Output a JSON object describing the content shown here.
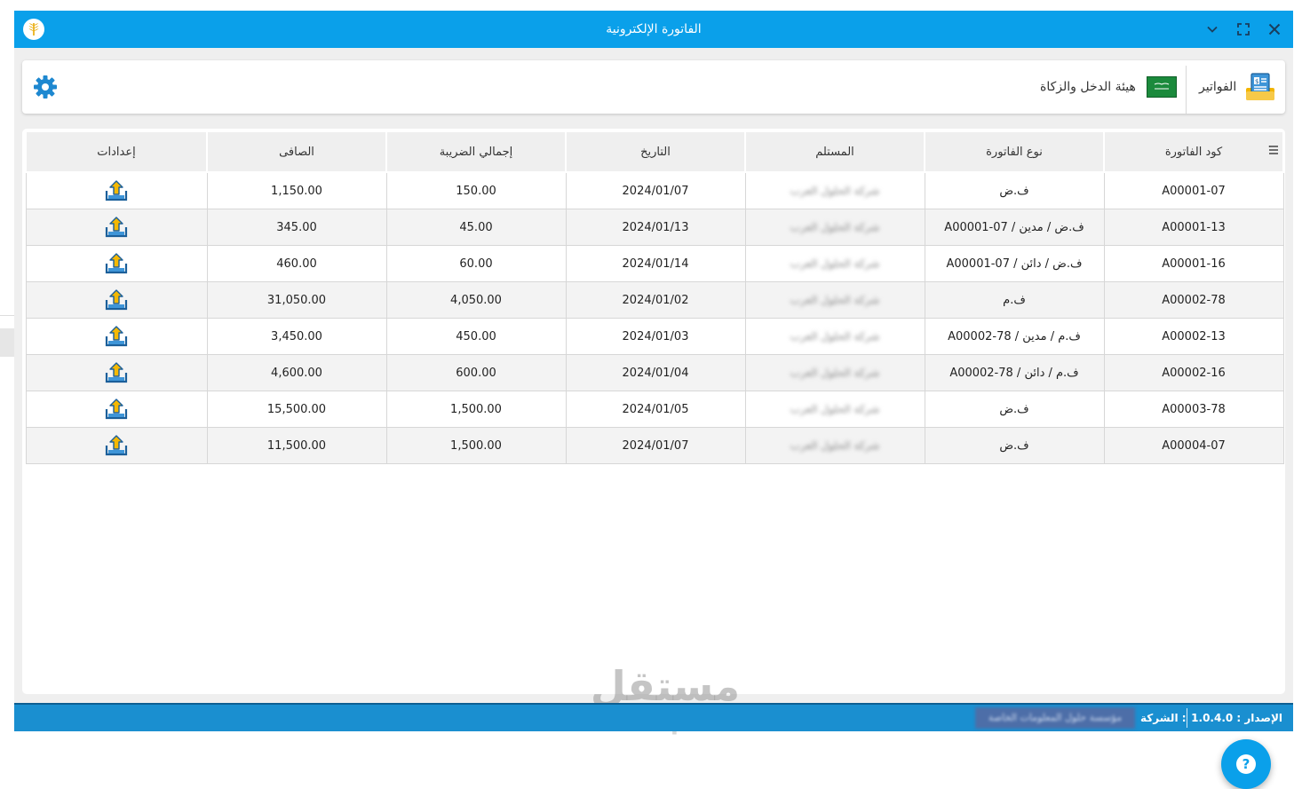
{
  "window": {
    "title": "الفاتورة الإلكترونية"
  },
  "toolbar": {
    "invoices_label": "الفواتير",
    "authority_label": "هيئة الدخل والزكاة"
  },
  "table": {
    "headers": {
      "code": "كود الفاتورة",
      "type": "نوع الفاتورة",
      "receiver": "المستلم",
      "date": "التاريخ",
      "tax_total": "إجمالي الضريبة",
      "net": "الصافى",
      "settings": "إعدادات"
    },
    "rows": [
      {
        "code": "A00001-07",
        "type": "ف.ض",
        "receiver": "شركة الحلول العرب",
        "date": "2024/01/07",
        "tax": "150.00",
        "net": "1,150.00"
      },
      {
        "code": "A00001-13",
        "type": "ف.ض / مدين / A00001-07",
        "receiver": "شركة الحلول العرب",
        "date": "2024/01/13",
        "tax": "45.00",
        "net": "345.00"
      },
      {
        "code": "A00001-16",
        "type": "ف.ض / دائن / A00001-07",
        "receiver": "شركة الحلول العرب",
        "date": "2024/01/14",
        "tax": "60.00",
        "net": "460.00"
      },
      {
        "code": "A00002-78",
        "type": "ف.م",
        "receiver": "شركة الحلول العرب",
        "date": "2024/01/02",
        "tax": "4,050.00",
        "net": "31,050.00"
      },
      {
        "code": "A00002-13",
        "type": "ف.م / مدين / A00002-78",
        "receiver": "شركة الحلول العرب",
        "date": "2024/01/03",
        "tax": "450.00",
        "net": "3,450.00"
      },
      {
        "code": "A00002-16",
        "type": "ف.م / دائن / A00002-78",
        "receiver": "شركة الحلول العرب",
        "date": "2024/01/04",
        "tax": "600.00",
        "net": "4,600.00"
      },
      {
        "code": "A00003-78",
        "type": "ف.ض",
        "receiver": "شركة الحلول العرب",
        "date": "2024/01/05",
        "tax": "1,500.00",
        "net": "15,500.00"
      },
      {
        "code": "A00004-07",
        "type": "ف.ض",
        "receiver": "شركة الحلول العرب",
        "date": "2024/01/07",
        "tax": "1,500.00",
        "net": "11,500.00"
      }
    ]
  },
  "statusbar": {
    "version_text": "الإصدار : 1.0.4.0",
    "company_label": "الشركة :",
    "company_value": "مؤسسة حلول المعلومات الخاصة"
  },
  "watermark": {
    "arabic": "مستقل",
    "latin": "mostaql.com"
  },
  "help": {
    "symbol": "?"
  },
  "colors": {
    "titlebar": "#0aa0ea",
    "statusbar": "#1a8fd0",
    "accent": "#0aa0ea",
    "upload_icon": "#f5b800"
  },
  "icons": {
    "app": "wheat-logo-icon",
    "settings": "gear-icon",
    "invoices": "invoice-icon",
    "authority": "saudi-flag-icon",
    "row_action": "upload-icon",
    "help": "question-icon"
  }
}
